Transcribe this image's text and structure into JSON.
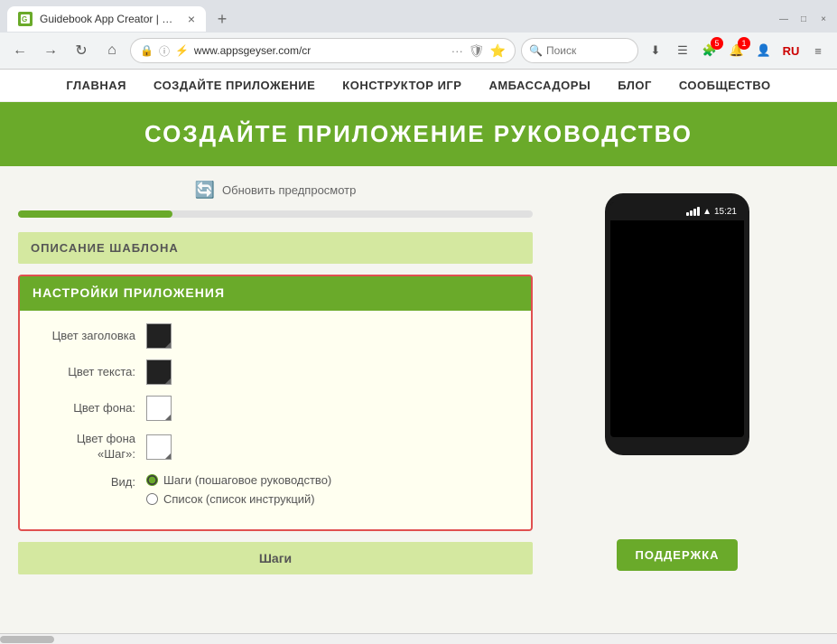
{
  "browser": {
    "tab": {
      "title": "Guidebook App Creator | Creat",
      "favicon_label": "G",
      "close_label": "×"
    },
    "new_tab_label": "+",
    "window_controls": {
      "minimize": "—",
      "maximize": "□",
      "close": "×"
    },
    "toolbar": {
      "back_label": "←",
      "forward_label": "→",
      "reload_label": "↻",
      "home_label": "⌂",
      "url": "www.appsgeyser.com/cr",
      "url_dots": "···",
      "search_placeholder": "Поиск"
    }
  },
  "site": {
    "nav_items": [
      "ГЛАВНАЯ",
      "СОЗДАЙТЕ ПРИЛОЖЕНИЕ",
      "КОНСТРУКТОР ИГР",
      "АМБАССАДОРЫ",
      "БЛОГ",
      "СООБЩЕСТВО"
    ]
  },
  "page": {
    "hero_title": "СОЗДАЙТЕ ПРИЛОЖЕНИЕ РУКОВОДСТВО",
    "refresh_label": "Обновить предпросмотр",
    "template_section": "ОПИСАНИЕ ШАБЛОНА",
    "settings": {
      "title": "НАСТРОЙКИ ПРИЛОЖЕНИЯ",
      "header_color_label": "Цвет заголовка",
      "text_color_label": "Цвет текста:",
      "bg_color_label": "Цвет фона:",
      "step_bg_color_label": "Цвет фона «Шаг»:",
      "view_label": "Вид:",
      "view_options": [
        "Шаги (пошаговое руководство)",
        "Список (список инструкций)"
      ]
    },
    "steps_section": "Шаги",
    "support_label": "ПОДДЕРЖКА"
  },
  "phone": {
    "time": "15:21"
  }
}
